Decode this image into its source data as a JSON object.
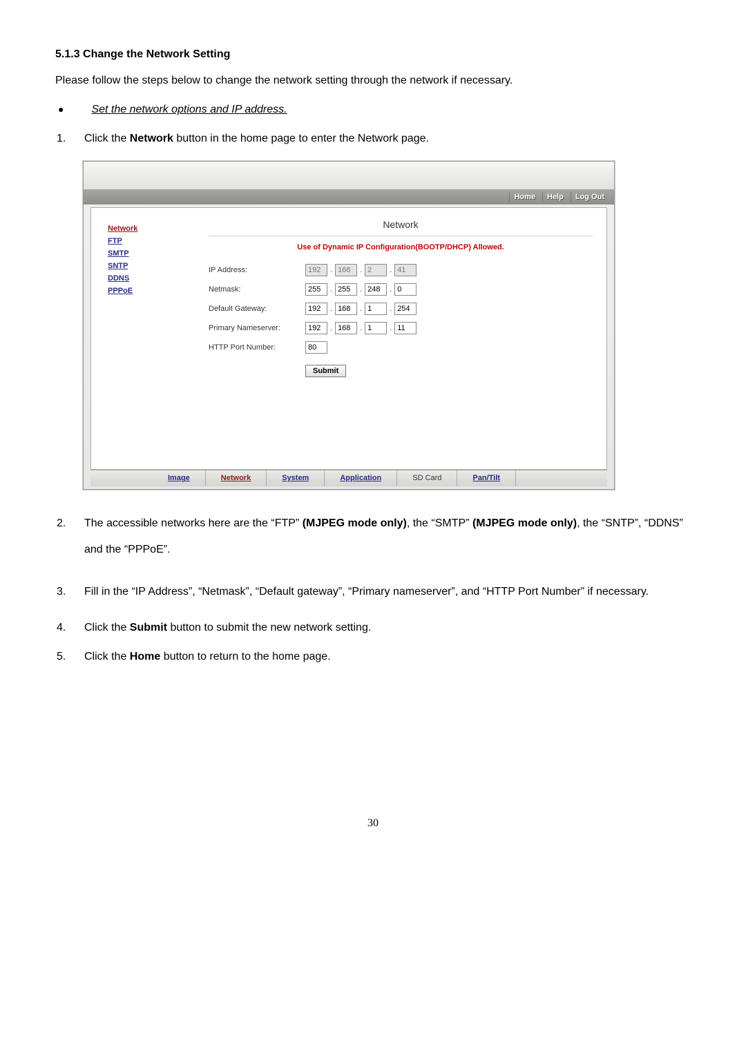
{
  "heading": "5.1.3  Change the Network Setting",
  "intro": "Please follow the steps below to change the network setting through the network if necessary.",
  "bullet": "Set the network options and IP address.",
  "step1_pre": "Click the ",
  "step1_bold": "Network",
  "step1_post": " button in the home page to enter the Network page.",
  "nav": {
    "home": "Home",
    "help": "Help",
    "logout": "Log Out"
  },
  "sidebar": {
    "items": [
      {
        "label": "Network",
        "active": true
      },
      {
        "label": "FTP"
      },
      {
        "label": "SMTP"
      },
      {
        "label": "SNTP"
      },
      {
        "label": "DDNS"
      },
      {
        "label": "PPPoE"
      }
    ]
  },
  "panel": {
    "title": "Network",
    "dhcp_msg": "Use of Dynamic IP Configuration(BOOTP/DHCP) Allowed.",
    "rows": {
      "ip": {
        "label": "IP Address:",
        "v": [
          "192",
          "168",
          "2",
          "41"
        ],
        "disabled": true
      },
      "mask": {
        "label": "Netmask:",
        "v": [
          "255",
          "255",
          "248",
          "0"
        ]
      },
      "gw": {
        "label": "Default Gateway:",
        "v": [
          "192",
          "168",
          "1",
          "254"
        ]
      },
      "dns": {
        "label": "Primary Nameserver:",
        "v": [
          "192",
          "168",
          "1",
          "11"
        ]
      },
      "port": {
        "label": "HTTP Port Number:",
        "v": "80"
      }
    },
    "submit": "Submit"
  },
  "tabs": [
    "Image",
    "Network",
    "System",
    "Application",
    "SD Card",
    "Pan/Tilt"
  ],
  "step2_a": "The accessible networks here are the “FTP” ",
  "step2_b1": "(MJPEG mode only)",
  "step2_c": ", the “SMTP” ",
  "step2_b2": "(MJPEG mode only)",
  "step2_d": ", the “SNTP”, “DDNS” and the “PPPoE”.",
  "step3": "Fill in the “IP Address”, “Netmask”, “Default gateway”, “Primary nameserver”, and “HTTP Port Number” if necessary.",
  "step4_a": "Click the ",
  "step4_b": "Submit",
  "step4_c": " button to submit the new network setting.",
  "step5_a": "Click the ",
  "step5_b": "Home",
  "step5_c": " button to return to the home page.",
  "page_number": "30"
}
